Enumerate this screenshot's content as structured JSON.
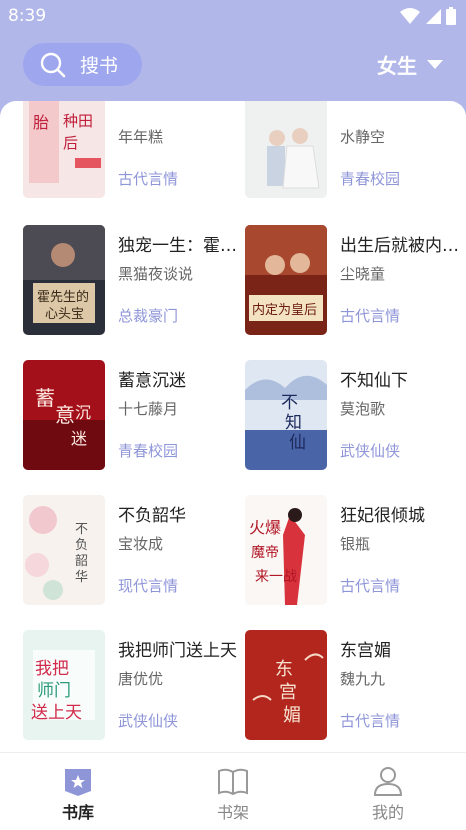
{
  "status_bar": {
    "time": "8:39",
    "icons": [
      "wifi-icon",
      "signal-icon",
      "battery-icon"
    ]
  },
  "header": {
    "search_label": "搜书",
    "gender_filter": "女生",
    "colors": {
      "header_bg": "#b2b7ea",
      "search_bg": "#9ea6ee",
      "tag_color": "#8f96d8"
    }
  },
  "books": [
    {
      "title": "",
      "author": "年年糕",
      "tag": "古代言情",
      "cover_text": "种田后 三胎"
    },
    {
      "title": "",
      "author": "水静空",
      "tag": "青春校园",
      "cover_text": ""
    },
    {
      "title": "独宠一生：霍先生的心头宝",
      "author": "黑猫夜谈说",
      "tag": "总裁豪门",
      "cover_text": "霍先生的 心头宝"
    },
    {
      "title": "出生后就被内定为皇后",
      "author": "尘晓童",
      "tag": "古代言情",
      "cover_text": "内定为皇后"
    },
    {
      "title": "蓄意沉迷",
      "author": "十七藤月",
      "tag": "青春校园",
      "cover_text": "蓄意沉迷"
    },
    {
      "title": "不知仙下",
      "author": "莫泡歌",
      "tag": "武侠仙侠",
      "cover_text": "不知仙下"
    },
    {
      "title": "不负韶华",
      "author": "宝妆成",
      "tag": "现代言情",
      "cover_text": "不负韶华"
    },
    {
      "title": "狂妃很倾城",
      "author": "银瓶",
      "tag": "古代言情",
      "cover_text": "火爆魔帝来一战"
    },
    {
      "title": "我把师门送上天",
      "author": "唐优优",
      "tag": "武侠仙侠",
      "cover_text": "我把师门送上天"
    },
    {
      "title": "东宫媚",
      "author": "魏九九",
      "tag": "古代言情",
      "cover_text": "东宫媚"
    }
  ],
  "tabbar": {
    "tabs": [
      {
        "label": "书库",
        "icon": "bookstore-icon",
        "active": true
      },
      {
        "label": "书架",
        "icon": "bookshelf-icon",
        "active": false
      },
      {
        "label": "我的",
        "icon": "profile-icon",
        "active": false
      }
    ]
  }
}
